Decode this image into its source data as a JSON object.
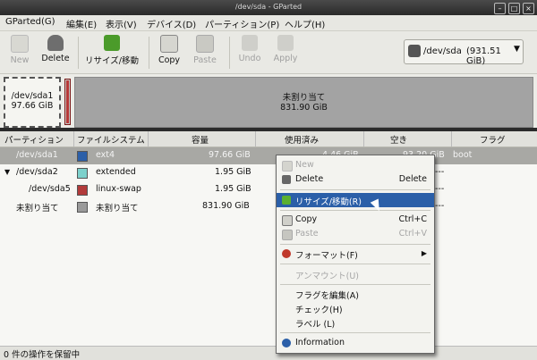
{
  "window": {
    "title": "/dev/sda - GParted"
  },
  "menubar": {
    "items": [
      "GParted(G)",
      "編集(E)",
      "表示(V)",
      "デバイス(D)",
      "パーティション(P)",
      "ヘルプ(H)"
    ]
  },
  "toolbar": {
    "new": "New",
    "delete": "Delete",
    "resize": "リサイズ/移動",
    "copy": "Copy",
    "paste": "Paste",
    "undo": "Undo",
    "apply": "Apply",
    "device": "/dev/sda",
    "device_size": "(931.51 GiB)"
  },
  "graph": {
    "p1_name": "/dev/sda1",
    "p1_size": "97.66 GiB",
    "unalloc_name": "未割り当て",
    "unalloc_size": "831.90 GiB"
  },
  "table": {
    "headers": [
      "パーティション",
      "ファイルシステム",
      "容量",
      "使用済み",
      "空き",
      "フラグ"
    ],
    "rows": [
      {
        "partition": "/dev/sda1",
        "fs": "ext4",
        "fs_color": "#2b5fa8",
        "size": "97.66 GiB",
        "used": "4.46 GiB",
        "free": "93.20 GiB",
        "flags": "boot"
      },
      {
        "partition": "/dev/sda2",
        "fs": "extended",
        "fs_color": "#7dd1cc",
        "size": "1.95 GiB",
        "used": "---",
        "free": "---",
        "flags": ""
      },
      {
        "partition": "/dev/sda5",
        "fs": "linux-swap",
        "fs_color": "#b23b3b",
        "size": "1.95 GiB",
        "used": "---",
        "free": "---",
        "flags": ""
      },
      {
        "partition": "未割り当て",
        "fs": "未割り当て",
        "fs_color": "#9a9a9a",
        "size": "831.90 GiB",
        "used": "---",
        "free": "---",
        "flags": ""
      }
    ]
  },
  "context_menu": {
    "new": "New",
    "delete": "Delete",
    "delete_acc": "Delete",
    "resize": "リサイズ/移動(R)",
    "copy": "Copy",
    "copy_acc": "Ctrl+C",
    "paste": "Paste",
    "paste_acc": "Ctrl+V",
    "format": "フォーマット(F)",
    "unmount": "アンマウント(U)",
    "flags": "フラグを編集(A)",
    "check": "チェック(H)",
    "label": "ラベル (L)",
    "information": "Information"
  },
  "status": {
    "text": "0 件の操作を保留中"
  }
}
